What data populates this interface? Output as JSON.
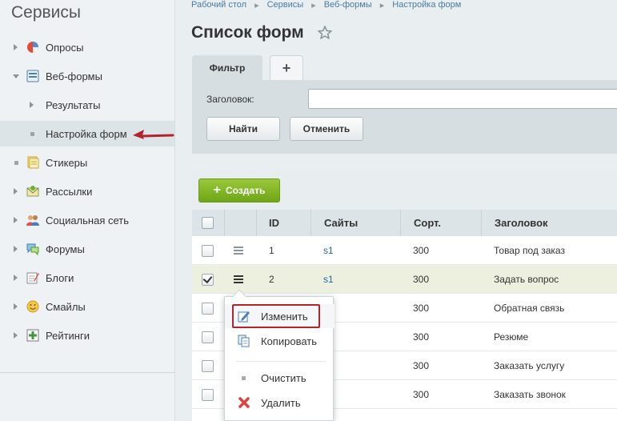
{
  "sidebar": {
    "title": "Сервисы",
    "items": [
      {
        "label": "Опросы",
        "icon": "poll-icon"
      },
      {
        "label": "Веб-формы",
        "icon": "webform-icon"
      },
      {
        "label": "Результаты"
      },
      {
        "label": "Настройка форм"
      },
      {
        "label": "Стикеры",
        "icon": "sticker-icon"
      },
      {
        "label": "Рассылки",
        "icon": "mailing-icon"
      },
      {
        "label": "Социальная сеть",
        "icon": "social-icon"
      },
      {
        "label": "Форумы",
        "icon": "forum-icon"
      },
      {
        "label": "Блоги",
        "icon": "blog-icon"
      },
      {
        "label": "Смайлы",
        "icon": "smile-icon"
      },
      {
        "label": "Рейтинги",
        "icon": "rating-icon"
      }
    ]
  },
  "breadcrumb": [
    "Рабочий стол",
    "Сервисы",
    "Веб-формы",
    "Настройка форм"
  ],
  "page_title": "Список форм",
  "filter": {
    "tab_label": "Фильтр",
    "add_tab_label": "+",
    "field_label": "Заголовок:",
    "field_value": "",
    "find_label": "Найти",
    "cancel_label": "Отменить"
  },
  "toolbar": {
    "create_label": "Создать"
  },
  "table": {
    "headers": {
      "id": "ID",
      "sites": "Сайты",
      "sort": "Сорт.",
      "title": "Заголовок"
    },
    "rows": [
      {
        "id": "1",
        "site": "s1",
        "sort": "300",
        "title": "Товар под заказ",
        "checked": false
      },
      {
        "id": "2",
        "site": "s1",
        "sort": "300",
        "title": "Задать вопрос",
        "checked": true
      },
      {
        "id": "",
        "site": "",
        "sort": "300",
        "title": "Обратная связь",
        "checked": false
      },
      {
        "id": "",
        "site": "",
        "sort": "300",
        "title": "Резюме",
        "checked": false
      },
      {
        "id": "",
        "site": "",
        "sort": "300",
        "title": "Заказать услугу",
        "checked": false
      },
      {
        "id": "",
        "site": "",
        "sort": "300",
        "title": "Заказать звонок",
        "checked": false
      }
    ]
  },
  "context_menu": {
    "edit": "Изменить",
    "copy": "Копировать",
    "clear": "Очистить",
    "delete": "Удалить"
  },
  "colors": {
    "accent_red": "#b3232c",
    "create_green": "#7fb524",
    "link_blue": "#2469a3"
  }
}
